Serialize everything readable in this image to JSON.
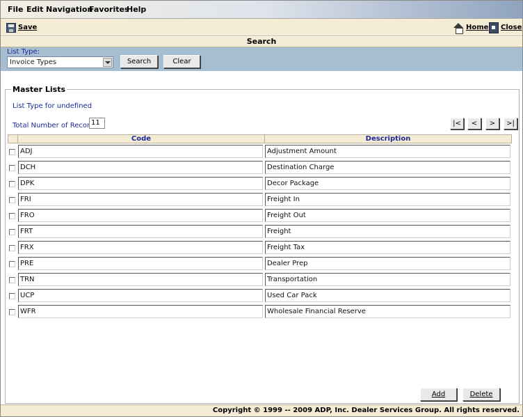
{
  "menu": [
    "File",
    "Edit",
    "Navigation",
    "Favorites",
    "Help"
  ],
  "toolbar": {
    "save_label": "Save",
    "home_label": "Home",
    "close_label": "Close"
  },
  "section_title": "Search",
  "search": {
    "list_type_label": "List Type:",
    "list_type_value": "Invoice Types",
    "search_button": "Search",
    "clear_button": "Clear"
  },
  "master": {
    "legend": "Master Lists",
    "subtitle": "List Type for undefined",
    "total_label": "Total Number of Records:",
    "total_value": "11",
    "pager": [
      "|<",
      "<",
      ">",
      ">|"
    ],
    "columns": {
      "code": "Code",
      "description": "Description"
    },
    "rows": [
      {
        "code": "ADJ",
        "description": "Adjustment Amount"
      },
      {
        "code": "DCH",
        "description": "Destination Charge"
      },
      {
        "code": "DPK",
        "description": "Decor Package"
      },
      {
        "code": "FRI",
        "description": "Freight In"
      },
      {
        "code": "FRO",
        "description": "Freight Out"
      },
      {
        "code": "FRT",
        "description": "Freight"
      },
      {
        "code": "FRX",
        "description": "Freight Tax"
      },
      {
        "code": "PRE",
        "description": "Dealer Prep"
      },
      {
        "code": "TRN",
        "description": "Transportation"
      },
      {
        "code": "UCP",
        "description": "Used Car Pack"
      },
      {
        "code": "WFR",
        "description": "Wholesale Financial Reserve"
      }
    ],
    "add_button": "Add",
    "delete_button": "Delete"
  },
  "footer": "Copyright © 1999 -- 2009 ADP, Inc. Dealer Services Group. All rights reserved."
}
